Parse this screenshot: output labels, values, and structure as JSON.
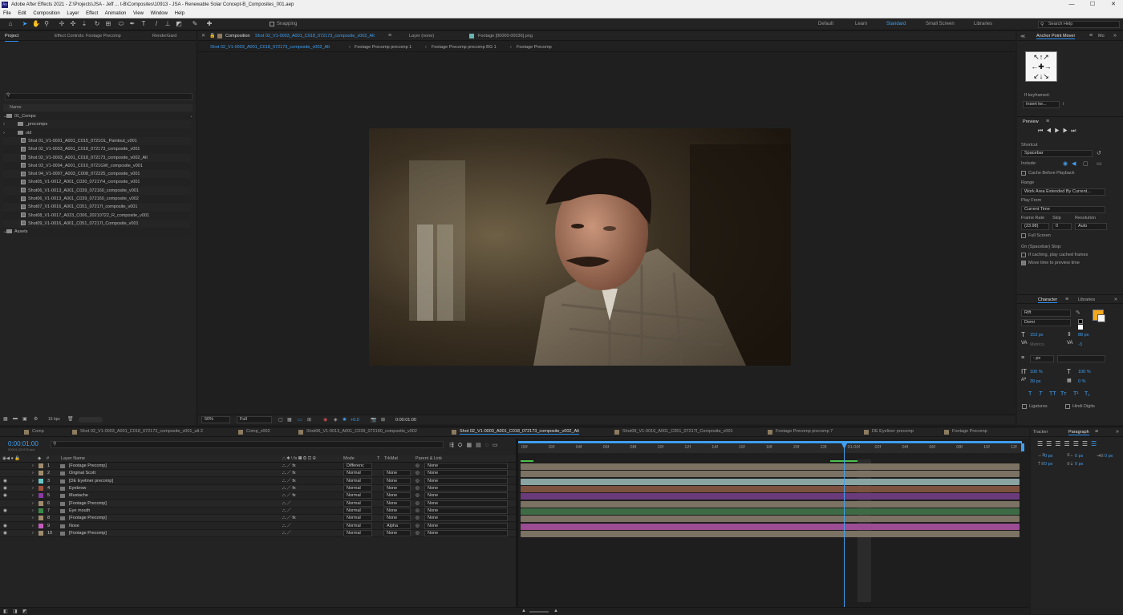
{
  "window": {
    "title": "Adobe After Effects 2021 - Z:\\Projects\\JSA - Jeff ... t-B\\Composites\\10913 - JSA - Renewable Solar Concept-B_Composites_001.aep",
    "app_icon": "Ae",
    "minimize": "—",
    "maximize": "☐",
    "close": "✕"
  },
  "menu": [
    "File",
    "Edit",
    "Composition",
    "Layer",
    "Effect",
    "Animation",
    "View",
    "Window",
    "Help"
  ],
  "toolbar": {
    "snapping": "Snapping",
    "workspaces": [
      "Default",
      "Learn",
      "Standard",
      "Small Screen",
      "Libraries"
    ],
    "active_workspace": "Standard",
    "search_placeholder": "Search Help"
  },
  "project": {
    "tabs": [
      "Project",
      "Effect Controls: Footage Precomp",
      "RenderGard"
    ],
    "search_placeholder": "",
    "column": "Name",
    "items": [
      {
        "label": "01_Comps",
        "kind": "folder",
        "indent": 0
      },
      {
        "label": "_precomps",
        "kind": "folder",
        "indent": 1
      },
      {
        "label": "old",
        "kind": "folder",
        "indent": 1
      },
      {
        "label": "Shot 01_V1-0001_A001_C015_0721OL_Paintout_v001",
        "kind": "comp",
        "indent": 1
      },
      {
        "label": "Shot 02_V1-0003_A001_C018_072173_composite_v001",
        "kind": "comp",
        "indent": 1
      },
      {
        "label": "Shot 02_V1-0003_A001_C018_072173_composite_v002_Alt",
        "kind": "comp",
        "indent": 1
      },
      {
        "label": "Shot 03_V1-0004_A001_C010_0721GW_composite_v001",
        "kind": "comp",
        "indent": 1
      },
      {
        "label": "Shot 04_V1-0007_A003_C008_072225_composite_v001",
        "kind": "comp",
        "indent": 1
      },
      {
        "label": "Shot05_V1-0012_A001_C030_0721YH_composite_v001",
        "kind": "comp",
        "indent": 1
      },
      {
        "label": "Shot06_V1-0013_A001_C039_072160_composite_v001",
        "kind": "comp",
        "indent": 1
      },
      {
        "label": "Shot06_V1-0013_A001_C039_072160_composite_v002",
        "kind": "comp",
        "indent": 1
      },
      {
        "label": "Shot07_V1-0016_A001_C051_07217I_composite_v001",
        "kind": "comp",
        "indent": 1
      },
      {
        "label": "Shot08_V1-0017_A023_C006_20210722_R_composite_v001",
        "kind": "comp",
        "indent": 1
      },
      {
        "label": "Shot09_V1-0016_A001_C051_07217I_Composite_v001",
        "kind": "comp",
        "indent": 1
      },
      {
        "label": "Assets",
        "kind": "folder",
        "indent": 0
      }
    ],
    "footer_bpc": "16 bpc"
  },
  "composition": {
    "header_prefix": "Composition",
    "header_name": "Shot 02_V1-0003_A001_C018_072173_composite_v002_Alt",
    "layer_tab": "Layer (none)",
    "footage_tab": "Footage [00000-00036].png",
    "breadcrumbs": [
      "Shot 02_V1-0003_A001_C018_072173_composite_v002_Alt",
      "Footage Precomp precomp 1",
      "Footage Precomp precomp BG 1",
      "Footage Precomp"
    ],
    "zoom": "50%",
    "resolution": "Full",
    "exposure": "+0.0",
    "timecode": "0:00:01:00"
  },
  "anchor": {
    "title": "Anchor Point Mover",
    "title2": "Mo",
    "if_keyframed": "If keyframed:",
    "insert": "Insert ke...",
    "info": "i"
  },
  "preview": {
    "title": "Preview",
    "shortcut_label": "Shortcut",
    "shortcut": "Spacebar",
    "include_label": "Include:",
    "cache_label": "Cache Before Playback",
    "range_label": "Range",
    "range": "Work Area Extended By Current...",
    "play_from_label": "Play From",
    "play_from": "Current Time",
    "frame_rate_label": "Frame Rate",
    "skip_label": "Skip",
    "resolution_label": "Resolution",
    "frame_rate": "(23.98)",
    "skip": "0",
    "resolution": "Auto",
    "full_screen": "Full Screen",
    "on_stop_label": "On (Spacebar) Stop:",
    "if_caching": "If caching, play cached frames",
    "move_time": "Move time to preview time"
  },
  "character": {
    "tabs": [
      "Character",
      "Libraries"
    ],
    "font": "Rift",
    "style": "Demi",
    "size": "153 px",
    "leading": "88 px",
    "kerning": "Metrics",
    "tracking": "-3",
    "stroke_unit": "- px",
    "vscale": "100 %",
    "hscale": "100 %",
    "baseline": "39 px",
    "tsume": "0 %",
    "fill_color": "#f2a81d",
    "style_buttons": [
      "T",
      "T",
      "TT",
      "Tт",
      "T¹",
      "T₁"
    ],
    "ligatures": "Ligatures",
    "hindi": "Hindi Digits"
  },
  "timeline": {
    "tabs": [
      "Comp",
      "Shot 02_V1-0003_A001_C018_072173_composite_v001_alt 2",
      "Comp_v002",
      "Shot06_V1-0013_A001_C039_072160_composite_v002",
      "Shot 02_V1-0003_A001_C018_072173_composite_v002_Alt",
      "Shot09_V1-0016_A001_C051_07217I_Composite_v001",
      "Footage Precomp precomp 7",
      "DE Eyeliner precomp",
      "Footage Precomp"
    ],
    "active_tab": 4,
    "current_time": "0:00:01:00",
    "fps_sub": "00024 (23.976 fps)",
    "col_layer_name": "Layer Name",
    "col_mode": "Mode",
    "col_t": "T",
    "col_trkmat": "TrkMat",
    "col_parent": "Parent & Link",
    "ruler": [
      "00f",
      "02f",
      "04f",
      "06f",
      "08f",
      "10f",
      "12f",
      "14f",
      "16f",
      "18f",
      "20f",
      "22f",
      "01:00f",
      "02f",
      "04f",
      "06f",
      "08f",
      "10f",
      "12f"
    ],
    "layers": [
      {
        "num": "1",
        "name": "[Footage Precomp]",
        "color": "#a08c6e",
        "mode": "Differenc",
        "trkmat": "",
        "parent": "None",
        "bar": "#7c7263",
        "eye": false,
        "fx": true
      },
      {
        "num": "2",
        "name": "Original Scott",
        "color": "#a08c6e",
        "mode": "Normal",
        "trkmat": "None",
        "parent": "None",
        "bar": "#7c7263",
        "eye": false,
        "fx": true
      },
      {
        "num": "3",
        "name": "[DE Eyeliner precomp]",
        "color": "#6cc7c7",
        "mode": "Normal",
        "trkmat": "None",
        "parent": "None",
        "bar": "#8aa3a3",
        "eye": true,
        "fx": true
      },
      {
        "num": "4",
        "name": "Eyebrow",
        "color": "#a0523b",
        "mode": "Normal",
        "trkmat": "None",
        "parent": "None",
        "bar": "#7d5140",
        "eye": true,
        "fx": true
      },
      {
        "num": "5",
        "name": "Mustache",
        "color": "#8a3aa0",
        "mode": "Normal",
        "trkmat": "None",
        "parent": "None",
        "bar": "#6a3b7b",
        "eye": true,
        "fx": true
      },
      {
        "num": "6",
        "name": "[Footage Precomp]",
        "color": "#a08c6e",
        "mode": "Normal",
        "trkmat": "None",
        "parent": "None",
        "bar": "#7c7263",
        "eye": false,
        "fx": false
      },
      {
        "num": "7",
        "name": "Eye mouth",
        "color": "#3a8a4a",
        "mode": "Normal",
        "trkmat": "None",
        "parent": "None",
        "bar": "#3e6b45",
        "eye": true,
        "fx": false
      },
      {
        "num": "8",
        "name": "[Footage Precomp]",
        "color": "#a08c6e",
        "mode": "Normal",
        "trkmat": "None",
        "parent": "None",
        "bar": "#7c7263",
        "eye": false,
        "fx": true
      },
      {
        "num": "9",
        "name": "Nose",
        "color": "#c55bbd",
        "mode": "Normal",
        "trkmat": "Alpha",
        "parent": "None",
        "bar": "#9b4c93",
        "eye": true,
        "fx": false
      },
      {
        "num": "10",
        "name": "[Footage Precomp]",
        "color": "#a08c6e",
        "mode": "Normal",
        "trkmat": "None",
        "parent": "None",
        "bar": "#7c7263",
        "eye": true,
        "fx": false
      }
    ],
    "playhead_fraction": 0.648
  },
  "paragraph": {
    "tabs": [
      "Tracker",
      "Paragraph"
    ],
    "indent_left": "0 px",
    "indent_right": "0 px",
    "indent_first": "0 px",
    "space_before": "0 px",
    "space_after": "0 px"
  }
}
